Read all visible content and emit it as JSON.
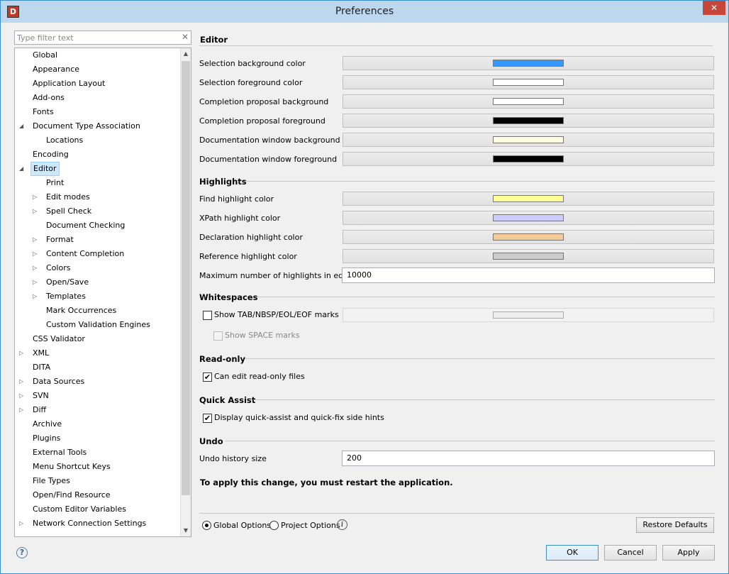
{
  "window": {
    "title": "Preferences",
    "close_glyph": "✕",
    "app_glyph": "D"
  },
  "filter": {
    "placeholder": "Type filter text",
    "clear_glyph": "✕"
  },
  "tree": [
    {
      "label": "Global",
      "level": 0,
      "toggle": ""
    },
    {
      "label": "Appearance",
      "level": 0,
      "toggle": ""
    },
    {
      "label": "Application Layout",
      "level": 0,
      "toggle": ""
    },
    {
      "label": "Add-ons",
      "level": 0,
      "toggle": ""
    },
    {
      "label": "Fonts",
      "level": 0,
      "toggle": ""
    },
    {
      "label": "Document Type Association",
      "level": 0,
      "toggle": "◢"
    },
    {
      "label": "Locations",
      "level": 1,
      "toggle": ""
    },
    {
      "label": "Encoding",
      "level": 0,
      "toggle": ""
    },
    {
      "label": "Editor",
      "level": 0,
      "toggle": "◢",
      "selected": true
    },
    {
      "label": "Print",
      "level": 1,
      "toggle": ""
    },
    {
      "label": "Edit modes",
      "level": 1,
      "toggle": "▷"
    },
    {
      "label": "Spell Check",
      "level": 1,
      "toggle": "▷"
    },
    {
      "label": "Document Checking",
      "level": 1,
      "toggle": ""
    },
    {
      "label": "Format",
      "level": 1,
      "toggle": "▷"
    },
    {
      "label": "Content Completion",
      "level": 1,
      "toggle": "▷"
    },
    {
      "label": "Colors",
      "level": 1,
      "toggle": "▷"
    },
    {
      "label": "Open/Save",
      "level": 1,
      "toggle": "▷"
    },
    {
      "label": "Templates",
      "level": 1,
      "toggle": "▷"
    },
    {
      "label": "Mark Occurrences",
      "level": 1,
      "toggle": ""
    },
    {
      "label": "Custom Validation Engines",
      "level": 1,
      "toggle": ""
    },
    {
      "label": "CSS Validator",
      "level": 0,
      "toggle": ""
    },
    {
      "label": "XML",
      "level": 0,
      "toggle": "▷"
    },
    {
      "label": "DITA",
      "level": 0,
      "toggle": ""
    },
    {
      "label": "Data Sources",
      "level": 0,
      "toggle": "▷"
    },
    {
      "label": "SVN",
      "level": 0,
      "toggle": "▷"
    },
    {
      "label": "Diff",
      "level": 0,
      "toggle": "▷"
    },
    {
      "label": "Archive",
      "level": 0,
      "toggle": ""
    },
    {
      "label": "Plugins",
      "level": 0,
      "toggle": ""
    },
    {
      "label": "External Tools",
      "level": 0,
      "toggle": ""
    },
    {
      "label": "Menu Shortcut Keys",
      "level": 0,
      "toggle": ""
    },
    {
      "label": "File Types",
      "level": 0,
      "toggle": ""
    },
    {
      "label": "Open/Find Resource",
      "level": 0,
      "toggle": ""
    },
    {
      "label": "Custom Editor Variables",
      "level": 0,
      "toggle": ""
    },
    {
      "label": "Network Connection Settings",
      "level": 0,
      "toggle": "▷"
    }
  ],
  "scroll": {
    "up_glyph": "▲",
    "down_glyph": "▼"
  },
  "sections": {
    "editor": "Editor",
    "highlights": "Highlights",
    "whitespaces": "Whitespaces",
    "readonly": "Read-only",
    "quickassist": "Quick Assist",
    "undo": "Undo"
  },
  "editor_colors": [
    {
      "label": "Selection background color",
      "color": "#3399ff"
    },
    {
      "label": "Selection foreground color",
      "color": "#ffffff"
    },
    {
      "label": "Completion proposal background",
      "color": "#ffffff"
    },
    {
      "label": "Completion proposal foreground",
      "color": "#000000"
    },
    {
      "label": "Documentation window background",
      "color": "#ffffe1"
    },
    {
      "label": "Documentation window foreground",
      "color": "#000000"
    }
  ],
  "highlight_colors": [
    {
      "label": "Find highlight color",
      "color": "#ffff99"
    },
    {
      "label": "XPath highlight color",
      "color": "#ccccff"
    },
    {
      "label": "Declaration highlight color",
      "color": "#f5cc99"
    },
    {
      "label": "Reference highlight color",
      "color": "#cccccc"
    }
  ],
  "max_highlights": {
    "label": "Maximum number of highlights in editor",
    "value": "10000"
  },
  "whitespaces": {
    "show_marks_label": "Show TAB/NBSP/EOL/EOF marks",
    "show_marks_checked": false,
    "marks_color": "#eeeeee",
    "show_space_label": "Show SPACE marks",
    "show_space_checked": false
  },
  "readonly": {
    "label": "Can edit read-only files",
    "checked": true
  },
  "quickassist": {
    "label": "Display quick-assist and quick-fix side hints",
    "checked": true
  },
  "undo": {
    "label": "Undo history size",
    "value": "200"
  },
  "restart_note": "To apply this change, you must restart the application.",
  "options": {
    "global_label": "Global Options",
    "project_label": "Project Options",
    "selected": "global",
    "info_glyph": "i"
  },
  "buttons": {
    "restore": "Restore Defaults",
    "ok": "OK",
    "cancel": "Cancel",
    "apply": "Apply",
    "help_glyph": "?"
  }
}
